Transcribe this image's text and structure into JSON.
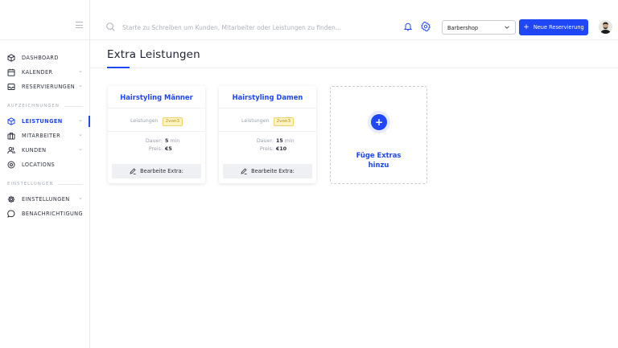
{
  "sidebar": {
    "items": [
      {
        "label": "DASHBOARD"
      },
      {
        "label": "KALENDER"
      },
      {
        "label": "RESERVIERUNGEN"
      },
      {
        "label": "LEISTUNGEN"
      },
      {
        "label": "MITARBEITER"
      },
      {
        "label": "KUNDEN"
      },
      {
        "label": "LOCATIONS"
      },
      {
        "label": "EINSTELLUNGEN"
      },
      {
        "label": "BENACHRICHTIGUNG"
      }
    ],
    "sections": {
      "records": "AUFZEICHNUNGEN",
      "settings": "EINSTELLUNGEN"
    },
    "active": "LEISTUNGEN"
  },
  "header": {
    "search_placeholder": "Starte zu Schreiben um Kunden, Mitarbeiter oder Leistungen zu finden...",
    "location_select": "Barbershop",
    "new_reservation": "Neue Reservierung",
    "plus": "+"
  },
  "main": {
    "title": "Extra Leistungen",
    "cards": [
      {
        "title": "Hairstyling Männer",
        "services_label": "Leistungen",
        "services_badge": "2von3",
        "duration_label": "Dauer:",
        "duration_value": "5",
        "duration_unit": "min",
        "price_label": "Preis:",
        "price_value": "€5",
        "edit_label": "Bearbeite Extra:"
      },
      {
        "title": "Hairstyling Damen",
        "services_label": "Leistungen",
        "services_badge": "2von3",
        "duration_label": "Dauer:",
        "duration_value": "15",
        "duration_unit": "min",
        "price_label": "Preis:",
        "price_value": "€10",
        "edit_label": "Bearbeite Extra:"
      }
    ],
    "add_card": {
      "plus": "+",
      "label_line1": "Füge Extras",
      "label_line2": "hinzu"
    }
  },
  "colors": {
    "accent": "#1f47f5",
    "badge_bg": "#fdf3c4",
    "text": "#2d2d3a"
  },
  "icons": [
    "hamburger-icon",
    "search-icon",
    "bell-icon",
    "gear-icon",
    "cube-icon",
    "calendar-icon",
    "inbox-icon",
    "briefcase-icon",
    "users-icon",
    "location-pin-icon",
    "chat-icon",
    "pencil-icon",
    "chevron-down-icon"
  ]
}
